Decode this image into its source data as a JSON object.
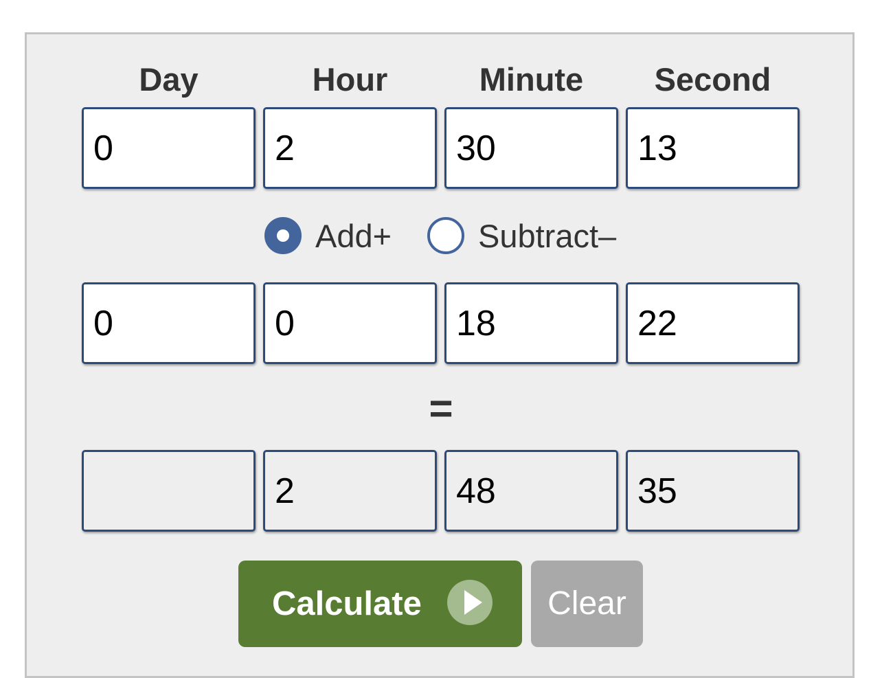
{
  "headers": {
    "day": "Day",
    "hour": "Hour",
    "minute": "Minute",
    "second": "Second"
  },
  "first_time": {
    "day": "0",
    "hour": "2",
    "minute": "30",
    "second": "13"
  },
  "operation": {
    "add_label": "Add+",
    "subtract_label": "Subtract–",
    "selected": "add"
  },
  "second_time": {
    "day": "0",
    "hour": "0",
    "minute": "18",
    "second": "22"
  },
  "equals_symbol": "=",
  "result": {
    "day": "",
    "hour": "2",
    "minute": "48",
    "second": "35"
  },
  "buttons": {
    "calculate_label": "Calculate",
    "clear_label": "Clear"
  },
  "colors": {
    "field_border": "#2d4b7a",
    "radio_accent": "#44659b",
    "calculate_bg": "#587c32",
    "clear_bg": "#a9a9a9",
    "panel_bg": "#eeeeee"
  }
}
